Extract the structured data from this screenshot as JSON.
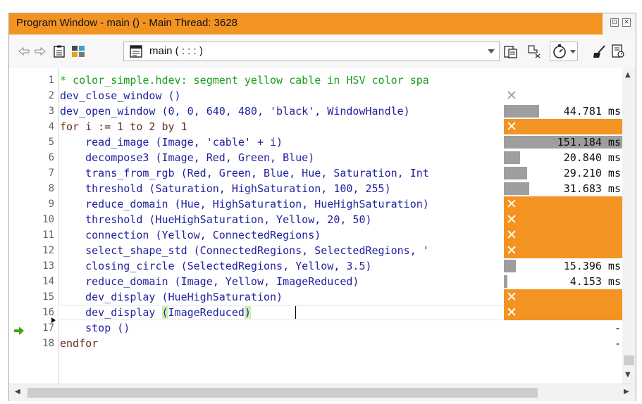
{
  "window": {
    "title": "Program Window - main () - Main Thread: 3628",
    "pin_glyph": "⊡",
    "close_glyph": "✕"
  },
  "toolbar": {
    "procedure": "main ( : : : )",
    "icons": [
      "back-arrow-icon",
      "forward-arrow-icon",
      "clipboard-icon",
      "grid-icon",
      "procedure-icon",
      "dropdown-arrow",
      "paste-icon",
      "clear-breakpoint-icon",
      "profiler-stopwatch-icon",
      "clean-icon",
      "report-icon"
    ]
  },
  "code": [
    {
      "line": "1",
      "text": "* color_simple.hdev: segment yellow cable in HSV color spa",
      "kind": "comment"
    },
    {
      "line": "2",
      "text": "dev_close_window ()",
      "kind": "op"
    },
    {
      "line": "3",
      "text": "dev_open_window (0, 0, 640, 480, 'black', WindowHandle)",
      "kind": "op"
    },
    {
      "line": "4",
      "text": "for i := 1 to 2 by 1",
      "kind": "ctrl"
    },
    {
      "line": "5",
      "text": "    read_image (Image, 'cable' + i)",
      "kind": "op"
    },
    {
      "line": "6",
      "text": "    decompose3 (Image, Red, Green, Blue)",
      "kind": "op"
    },
    {
      "line": "7",
      "text": "    trans_from_rgb (Red, Green, Blue, Hue, Saturation, Int",
      "kind": "op"
    },
    {
      "line": "8",
      "text": "    threshold (Saturation, HighSaturation, 100, 255)",
      "kind": "op"
    },
    {
      "line": "9",
      "text": "    reduce_domain (Hue, HighSaturation, HueHighSaturation)",
      "kind": "op"
    },
    {
      "line": "10",
      "text": "    threshold (HueHighSaturation, Yellow, 20, 50)",
      "kind": "op"
    },
    {
      "line": "11",
      "text": "    connection (Yellow, ConnectedRegions)",
      "kind": "op"
    },
    {
      "line": "12",
      "text": "    select_shape_std (ConnectedRegions, SelectedRegions, '",
      "kind": "op"
    },
    {
      "line": "13",
      "text": "    closing_circle (SelectedRegions, Yellow, 3.5)",
      "kind": "op"
    },
    {
      "line": "14",
      "text": "    reduce_domain (Image, Yellow, ImageReduced)",
      "kind": "op"
    },
    {
      "line": "15",
      "text": "    dev_display (HueHighSaturation)",
      "kind": "op"
    },
    {
      "line": "16",
      "text_pre": "    dev_display ",
      "text_lp": "(",
      "text_mid": "ImageReduced",
      "text_rp": ")",
      "kind": "op"
    },
    {
      "line": "17",
      "text": "    stop ()",
      "kind": "op"
    },
    {
      "line": "18",
      "text": "endfor",
      "kind": "ctrl"
    }
  ],
  "profiler": [
    {
      "row": "2",
      "type": "gray-x"
    },
    {
      "row": "3",
      "time": "44.781 ms",
      "fraction": 0.296
    },
    {
      "row": "4",
      "type": "orange"
    },
    {
      "row": "5",
      "time": "151.184 ms",
      "fraction": 1.0
    },
    {
      "row": "6",
      "time": "20.840 ms",
      "fraction": 0.138
    },
    {
      "row": "7",
      "time": "29.210 ms",
      "fraction": 0.193
    },
    {
      "row": "8",
      "time": "31.683 ms",
      "fraction": 0.21
    },
    {
      "row": "9",
      "type": "orange"
    },
    {
      "row": "10",
      "type": "orange"
    },
    {
      "row": "11",
      "type": "orange"
    },
    {
      "row": "12",
      "type": "orange"
    },
    {
      "row": "13",
      "time": "15.396 ms",
      "fraction": 0.102
    },
    {
      "row": "14",
      "time": "4.153 ms",
      "fraction": 0.027
    },
    {
      "row": "15",
      "type": "orange"
    },
    {
      "row": "16",
      "type": "orange"
    },
    {
      "row": "17",
      "time": "-"
    },
    {
      "row": "18",
      "time": "-"
    }
  ],
  "execution_line": "17",
  "colors": {
    "title_bg": "#f39321",
    "profile_orange": "#f39321",
    "profile_bar": "#9e9e9e",
    "comment": "#1a9e1a",
    "code": "#1f1fa0",
    "control": "#6a2a16",
    "pc_arrow": "#39a800",
    "bracket_highlight": "#cfeeb0"
  }
}
